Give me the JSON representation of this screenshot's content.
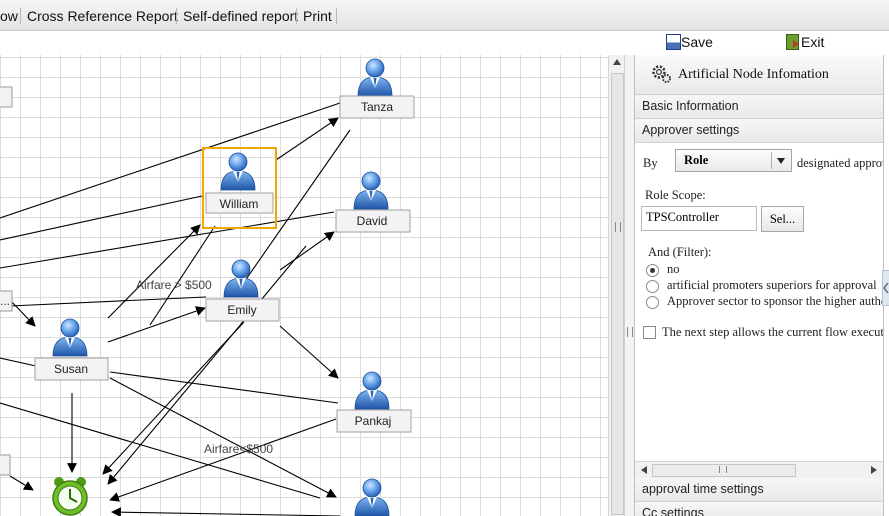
{
  "tabs": [
    {
      "label": "ow"
    },
    {
      "label": "Cross Reference Report"
    },
    {
      "label": "Self-defined report"
    },
    {
      "label": "Print"
    }
  ],
  "toolbar": {
    "save_label": "Save",
    "exit_label": "Exit"
  },
  "canvas": {
    "nodes": [
      "Tanza",
      "William",
      "David",
      "Emily",
      "Susan",
      "Pankaj"
    ],
    "edge_labels": [
      "Airfare > $500",
      "Airfare<$500"
    ],
    "partial_box_label": "..."
  },
  "panel": {
    "title": "Artificial Node Infomation",
    "sections": {
      "basic": "Basic Information",
      "approver": "Approver settings",
      "approval_time": "approval time settings",
      "cc": "Cc settings"
    },
    "by_label": "By",
    "by_value": "Role",
    "designated_label": "designated approv",
    "role_scope_label": "Role Scope:",
    "role_scope_value": "TPSController",
    "sel_button": "Sel...",
    "filter_label": "And (Filter):",
    "options": [
      {
        "label": "no",
        "selected": true
      },
      {
        "label": "artificial promoters superiors for approval",
        "selected": false
      },
      {
        "label": "Approver sector to sponsor the higher autho",
        "selected": false
      }
    ],
    "next_step_label": "The next step allows the current flow executo"
  },
  "colors": {
    "selection_border": "#f0a800",
    "node_icon": "#3a78c9",
    "timer_icon": "#5fae1f"
  }
}
